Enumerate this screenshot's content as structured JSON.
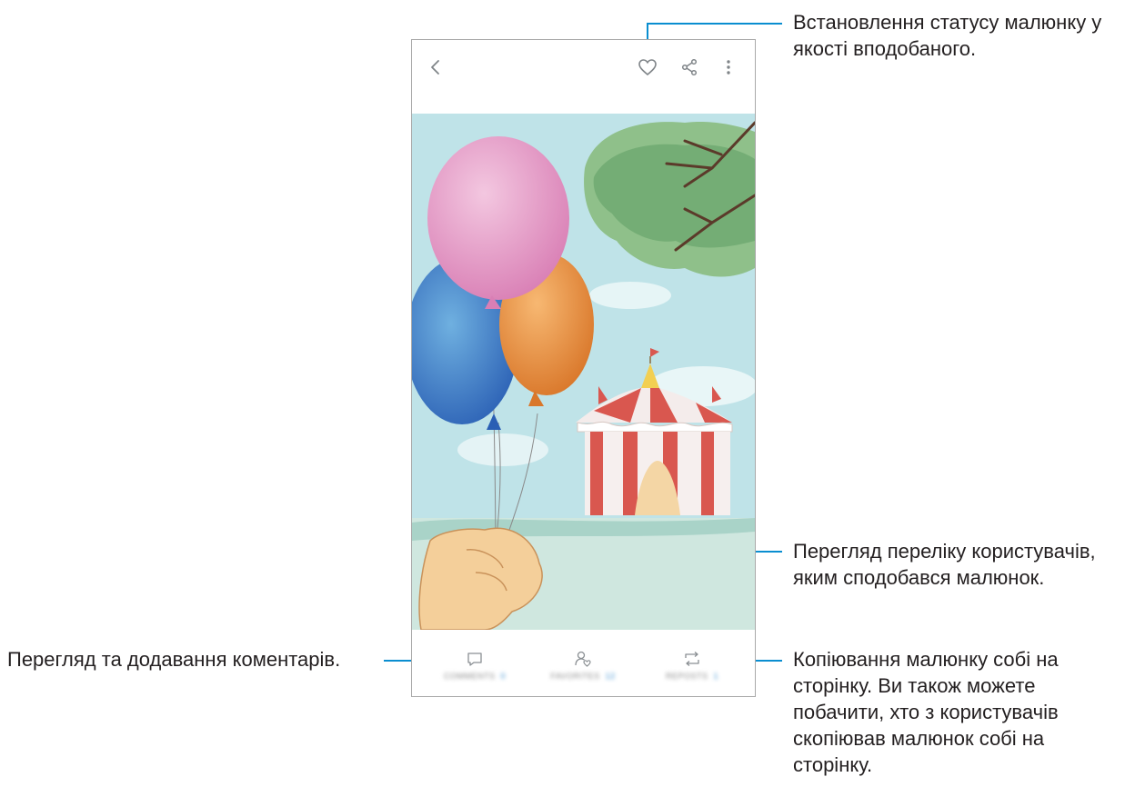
{
  "app": {
    "toolbar": {
      "back_icon": "chevron-left-icon",
      "like_icon": "heart-outline-icon",
      "share_icon": "share-icon",
      "more_icon": "more-vertical-icon"
    },
    "artwork": {
      "subject": "drawing-balloons-circus-tent"
    },
    "bottom_bar": {
      "comments": {
        "icon": "comment-icon",
        "label": "COMMENTS",
        "count": "0"
      },
      "favorites": {
        "icon": "liked-users-icon",
        "label": "FAVORITES",
        "count": "12"
      },
      "reposts": {
        "icon": "repost-icon",
        "label": "REPOSTS",
        "count": "1"
      }
    }
  },
  "callouts": {
    "like": [
      "Встановлення статусу малюнку у",
      "якості вподобаного."
    ],
    "liked_users": [
      "Перегляд переліку користувачів,",
      "яким сподобався малюнок."
    ],
    "comments": [
      "Перегляд та додавання коментарів."
    ],
    "repost": [
      "Копіювання малюнку собі на",
      "сторінку. Ви також можете",
      "побачити, хто з користувачів",
      "скопіював малюнок собі на",
      "сторінку."
    ]
  },
  "colors": {
    "leader": "#0a8ed0",
    "icon": "#7f8488",
    "sky": "#bfe3e8",
    "grass": "#cfe7df"
  }
}
